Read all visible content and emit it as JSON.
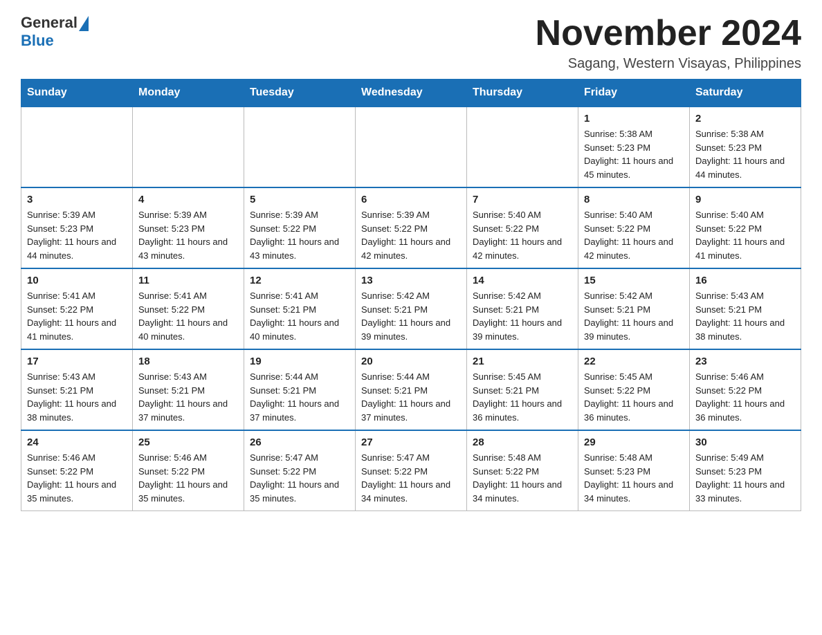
{
  "header": {
    "logo_general": "General",
    "logo_blue": "Blue",
    "month_title": "November 2024",
    "location": "Sagang, Western Visayas, Philippines"
  },
  "days_of_week": [
    "Sunday",
    "Monday",
    "Tuesday",
    "Wednesday",
    "Thursday",
    "Friday",
    "Saturday"
  ],
  "weeks": [
    [
      {
        "day": "",
        "info": ""
      },
      {
        "day": "",
        "info": ""
      },
      {
        "day": "",
        "info": ""
      },
      {
        "day": "",
        "info": ""
      },
      {
        "day": "",
        "info": ""
      },
      {
        "day": "1",
        "info": "Sunrise: 5:38 AM\nSunset: 5:23 PM\nDaylight: 11 hours and 45 minutes."
      },
      {
        "day": "2",
        "info": "Sunrise: 5:38 AM\nSunset: 5:23 PM\nDaylight: 11 hours and 44 minutes."
      }
    ],
    [
      {
        "day": "3",
        "info": "Sunrise: 5:39 AM\nSunset: 5:23 PM\nDaylight: 11 hours and 44 minutes."
      },
      {
        "day": "4",
        "info": "Sunrise: 5:39 AM\nSunset: 5:23 PM\nDaylight: 11 hours and 43 minutes."
      },
      {
        "day": "5",
        "info": "Sunrise: 5:39 AM\nSunset: 5:22 PM\nDaylight: 11 hours and 43 minutes."
      },
      {
        "day": "6",
        "info": "Sunrise: 5:39 AM\nSunset: 5:22 PM\nDaylight: 11 hours and 42 minutes."
      },
      {
        "day": "7",
        "info": "Sunrise: 5:40 AM\nSunset: 5:22 PM\nDaylight: 11 hours and 42 minutes."
      },
      {
        "day": "8",
        "info": "Sunrise: 5:40 AM\nSunset: 5:22 PM\nDaylight: 11 hours and 42 minutes."
      },
      {
        "day": "9",
        "info": "Sunrise: 5:40 AM\nSunset: 5:22 PM\nDaylight: 11 hours and 41 minutes."
      }
    ],
    [
      {
        "day": "10",
        "info": "Sunrise: 5:41 AM\nSunset: 5:22 PM\nDaylight: 11 hours and 41 minutes."
      },
      {
        "day": "11",
        "info": "Sunrise: 5:41 AM\nSunset: 5:22 PM\nDaylight: 11 hours and 40 minutes."
      },
      {
        "day": "12",
        "info": "Sunrise: 5:41 AM\nSunset: 5:21 PM\nDaylight: 11 hours and 40 minutes."
      },
      {
        "day": "13",
        "info": "Sunrise: 5:42 AM\nSunset: 5:21 PM\nDaylight: 11 hours and 39 minutes."
      },
      {
        "day": "14",
        "info": "Sunrise: 5:42 AM\nSunset: 5:21 PM\nDaylight: 11 hours and 39 minutes."
      },
      {
        "day": "15",
        "info": "Sunrise: 5:42 AM\nSunset: 5:21 PM\nDaylight: 11 hours and 39 minutes."
      },
      {
        "day": "16",
        "info": "Sunrise: 5:43 AM\nSunset: 5:21 PM\nDaylight: 11 hours and 38 minutes."
      }
    ],
    [
      {
        "day": "17",
        "info": "Sunrise: 5:43 AM\nSunset: 5:21 PM\nDaylight: 11 hours and 38 minutes."
      },
      {
        "day": "18",
        "info": "Sunrise: 5:43 AM\nSunset: 5:21 PM\nDaylight: 11 hours and 37 minutes."
      },
      {
        "day": "19",
        "info": "Sunrise: 5:44 AM\nSunset: 5:21 PM\nDaylight: 11 hours and 37 minutes."
      },
      {
        "day": "20",
        "info": "Sunrise: 5:44 AM\nSunset: 5:21 PM\nDaylight: 11 hours and 37 minutes."
      },
      {
        "day": "21",
        "info": "Sunrise: 5:45 AM\nSunset: 5:21 PM\nDaylight: 11 hours and 36 minutes."
      },
      {
        "day": "22",
        "info": "Sunrise: 5:45 AM\nSunset: 5:22 PM\nDaylight: 11 hours and 36 minutes."
      },
      {
        "day": "23",
        "info": "Sunrise: 5:46 AM\nSunset: 5:22 PM\nDaylight: 11 hours and 36 minutes."
      }
    ],
    [
      {
        "day": "24",
        "info": "Sunrise: 5:46 AM\nSunset: 5:22 PM\nDaylight: 11 hours and 35 minutes."
      },
      {
        "day": "25",
        "info": "Sunrise: 5:46 AM\nSunset: 5:22 PM\nDaylight: 11 hours and 35 minutes."
      },
      {
        "day": "26",
        "info": "Sunrise: 5:47 AM\nSunset: 5:22 PM\nDaylight: 11 hours and 35 minutes."
      },
      {
        "day": "27",
        "info": "Sunrise: 5:47 AM\nSunset: 5:22 PM\nDaylight: 11 hours and 34 minutes."
      },
      {
        "day": "28",
        "info": "Sunrise: 5:48 AM\nSunset: 5:22 PM\nDaylight: 11 hours and 34 minutes."
      },
      {
        "day": "29",
        "info": "Sunrise: 5:48 AM\nSunset: 5:23 PM\nDaylight: 11 hours and 34 minutes."
      },
      {
        "day": "30",
        "info": "Sunrise: 5:49 AM\nSunset: 5:23 PM\nDaylight: 11 hours and 33 minutes."
      }
    ]
  ]
}
